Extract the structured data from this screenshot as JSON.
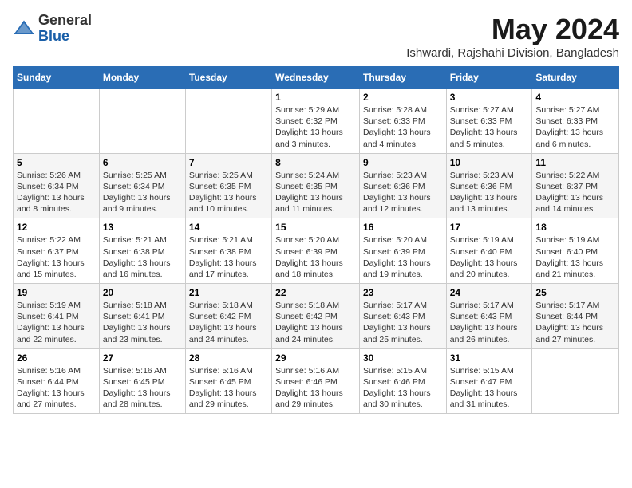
{
  "logo": {
    "general": "General",
    "blue": "Blue"
  },
  "title": "May 2024",
  "subtitle": "Ishwardi, Rajshahi Division, Bangladesh",
  "weekdays": [
    "Sunday",
    "Monday",
    "Tuesday",
    "Wednesday",
    "Thursday",
    "Friday",
    "Saturday"
  ],
  "weeks": [
    [
      {
        "day": "",
        "info": ""
      },
      {
        "day": "",
        "info": ""
      },
      {
        "day": "",
        "info": ""
      },
      {
        "day": "1",
        "info": "Sunrise: 5:29 AM\nSunset: 6:32 PM\nDaylight: 13 hours and 3 minutes."
      },
      {
        "day": "2",
        "info": "Sunrise: 5:28 AM\nSunset: 6:33 PM\nDaylight: 13 hours and 4 minutes."
      },
      {
        "day": "3",
        "info": "Sunrise: 5:27 AM\nSunset: 6:33 PM\nDaylight: 13 hours and 5 minutes."
      },
      {
        "day": "4",
        "info": "Sunrise: 5:27 AM\nSunset: 6:33 PM\nDaylight: 13 hours and 6 minutes."
      }
    ],
    [
      {
        "day": "5",
        "info": "Sunrise: 5:26 AM\nSunset: 6:34 PM\nDaylight: 13 hours and 8 minutes."
      },
      {
        "day": "6",
        "info": "Sunrise: 5:25 AM\nSunset: 6:34 PM\nDaylight: 13 hours and 9 minutes."
      },
      {
        "day": "7",
        "info": "Sunrise: 5:25 AM\nSunset: 6:35 PM\nDaylight: 13 hours and 10 minutes."
      },
      {
        "day": "8",
        "info": "Sunrise: 5:24 AM\nSunset: 6:35 PM\nDaylight: 13 hours and 11 minutes."
      },
      {
        "day": "9",
        "info": "Sunrise: 5:23 AM\nSunset: 6:36 PM\nDaylight: 13 hours and 12 minutes."
      },
      {
        "day": "10",
        "info": "Sunrise: 5:23 AM\nSunset: 6:36 PM\nDaylight: 13 hours and 13 minutes."
      },
      {
        "day": "11",
        "info": "Sunrise: 5:22 AM\nSunset: 6:37 PM\nDaylight: 13 hours and 14 minutes."
      }
    ],
    [
      {
        "day": "12",
        "info": "Sunrise: 5:22 AM\nSunset: 6:37 PM\nDaylight: 13 hours and 15 minutes."
      },
      {
        "day": "13",
        "info": "Sunrise: 5:21 AM\nSunset: 6:38 PM\nDaylight: 13 hours and 16 minutes."
      },
      {
        "day": "14",
        "info": "Sunrise: 5:21 AM\nSunset: 6:38 PM\nDaylight: 13 hours and 17 minutes."
      },
      {
        "day": "15",
        "info": "Sunrise: 5:20 AM\nSunset: 6:39 PM\nDaylight: 13 hours and 18 minutes."
      },
      {
        "day": "16",
        "info": "Sunrise: 5:20 AM\nSunset: 6:39 PM\nDaylight: 13 hours and 19 minutes."
      },
      {
        "day": "17",
        "info": "Sunrise: 5:19 AM\nSunset: 6:40 PM\nDaylight: 13 hours and 20 minutes."
      },
      {
        "day": "18",
        "info": "Sunrise: 5:19 AM\nSunset: 6:40 PM\nDaylight: 13 hours and 21 minutes."
      }
    ],
    [
      {
        "day": "19",
        "info": "Sunrise: 5:19 AM\nSunset: 6:41 PM\nDaylight: 13 hours and 22 minutes."
      },
      {
        "day": "20",
        "info": "Sunrise: 5:18 AM\nSunset: 6:41 PM\nDaylight: 13 hours and 23 minutes."
      },
      {
        "day": "21",
        "info": "Sunrise: 5:18 AM\nSunset: 6:42 PM\nDaylight: 13 hours and 24 minutes."
      },
      {
        "day": "22",
        "info": "Sunrise: 5:18 AM\nSunset: 6:42 PM\nDaylight: 13 hours and 24 minutes."
      },
      {
        "day": "23",
        "info": "Sunrise: 5:17 AM\nSunset: 6:43 PM\nDaylight: 13 hours and 25 minutes."
      },
      {
        "day": "24",
        "info": "Sunrise: 5:17 AM\nSunset: 6:43 PM\nDaylight: 13 hours and 26 minutes."
      },
      {
        "day": "25",
        "info": "Sunrise: 5:17 AM\nSunset: 6:44 PM\nDaylight: 13 hours and 27 minutes."
      }
    ],
    [
      {
        "day": "26",
        "info": "Sunrise: 5:16 AM\nSunset: 6:44 PM\nDaylight: 13 hours and 27 minutes."
      },
      {
        "day": "27",
        "info": "Sunrise: 5:16 AM\nSunset: 6:45 PM\nDaylight: 13 hours and 28 minutes."
      },
      {
        "day": "28",
        "info": "Sunrise: 5:16 AM\nSunset: 6:45 PM\nDaylight: 13 hours and 29 minutes."
      },
      {
        "day": "29",
        "info": "Sunrise: 5:16 AM\nSunset: 6:46 PM\nDaylight: 13 hours and 29 minutes."
      },
      {
        "day": "30",
        "info": "Sunrise: 5:15 AM\nSunset: 6:46 PM\nDaylight: 13 hours and 30 minutes."
      },
      {
        "day": "31",
        "info": "Sunrise: 5:15 AM\nSunset: 6:47 PM\nDaylight: 13 hours and 31 minutes."
      },
      {
        "day": "",
        "info": ""
      }
    ]
  ]
}
